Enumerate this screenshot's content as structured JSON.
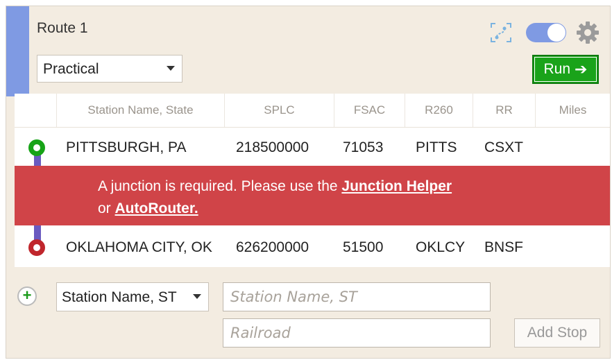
{
  "route": {
    "title": "Route 1",
    "routing_mode": "Practical",
    "run_label": "Run"
  },
  "colors": {
    "accent": "#7f9ae3",
    "run_green": "#1aa31a",
    "error_red": "#d04448",
    "start_marker": "#17a317",
    "end_marker": "#c0262c",
    "route_line": "#6a5ac0"
  },
  "toolbar": {
    "map_icon": "map-route-icon",
    "toggle_state": "on",
    "settings_icon": "gear-icon"
  },
  "table": {
    "headers": [
      "Station Name, State",
      "SPLC",
      "FSAC",
      "R260",
      "RR",
      "Miles"
    ],
    "rows": [
      {
        "station": "PITTSBURGH, PA",
        "splc": "218500000",
        "fsac": "71053",
        "r260": "PITTS",
        "rr": "CSXT",
        "miles": ""
      },
      {
        "station": "OKLAHOMA CITY, OK",
        "splc": "626200000",
        "fsac": "51500",
        "r260": "OKLCY",
        "rr": "BNSF",
        "miles": ""
      }
    ]
  },
  "error": {
    "text_before": "A junction is required. Please use the ",
    "junction_link": "Junction Helper",
    "text_or": "or ",
    "autorouter_link": "AutoRouter."
  },
  "add_stop": {
    "search_type": "Station Name, ST",
    "station_placeholder": "Station Name, ST",
    "railroad_placeholder": "Railroad",
    "button_label": "Add Stop"
  }
}
